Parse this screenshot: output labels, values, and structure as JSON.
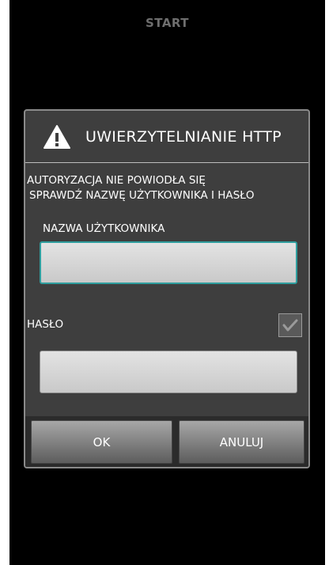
{
  "screen": {
    "top_title": "START"
  },
  "dialog": {
    "icon": "warning-icon",
    "title": "UWIERZYTELNIANIE HTTP",
    "message_line1": "AUTORYZACJA NIE POWIODŁA SIĘ",
    "message_line2": "SPRAWDŹ NAZWĘ UŻYTKOWNIKA I HASŁO",
    "username_label": "NAZWA UŻYTKOWNIKA",
    "username_value": "",
    "password_label": "HASŁO",
    "password_value": "",
    "show_password_checked": true,
    "ok_label": "OK",
    "cancel_label": "ANULUJ"
  },
  "colors": {
    "background": "#000000",
    "dialog_bg": "#3e3e3e",
    "focus_border": "#2f9e9e"
  }
}
